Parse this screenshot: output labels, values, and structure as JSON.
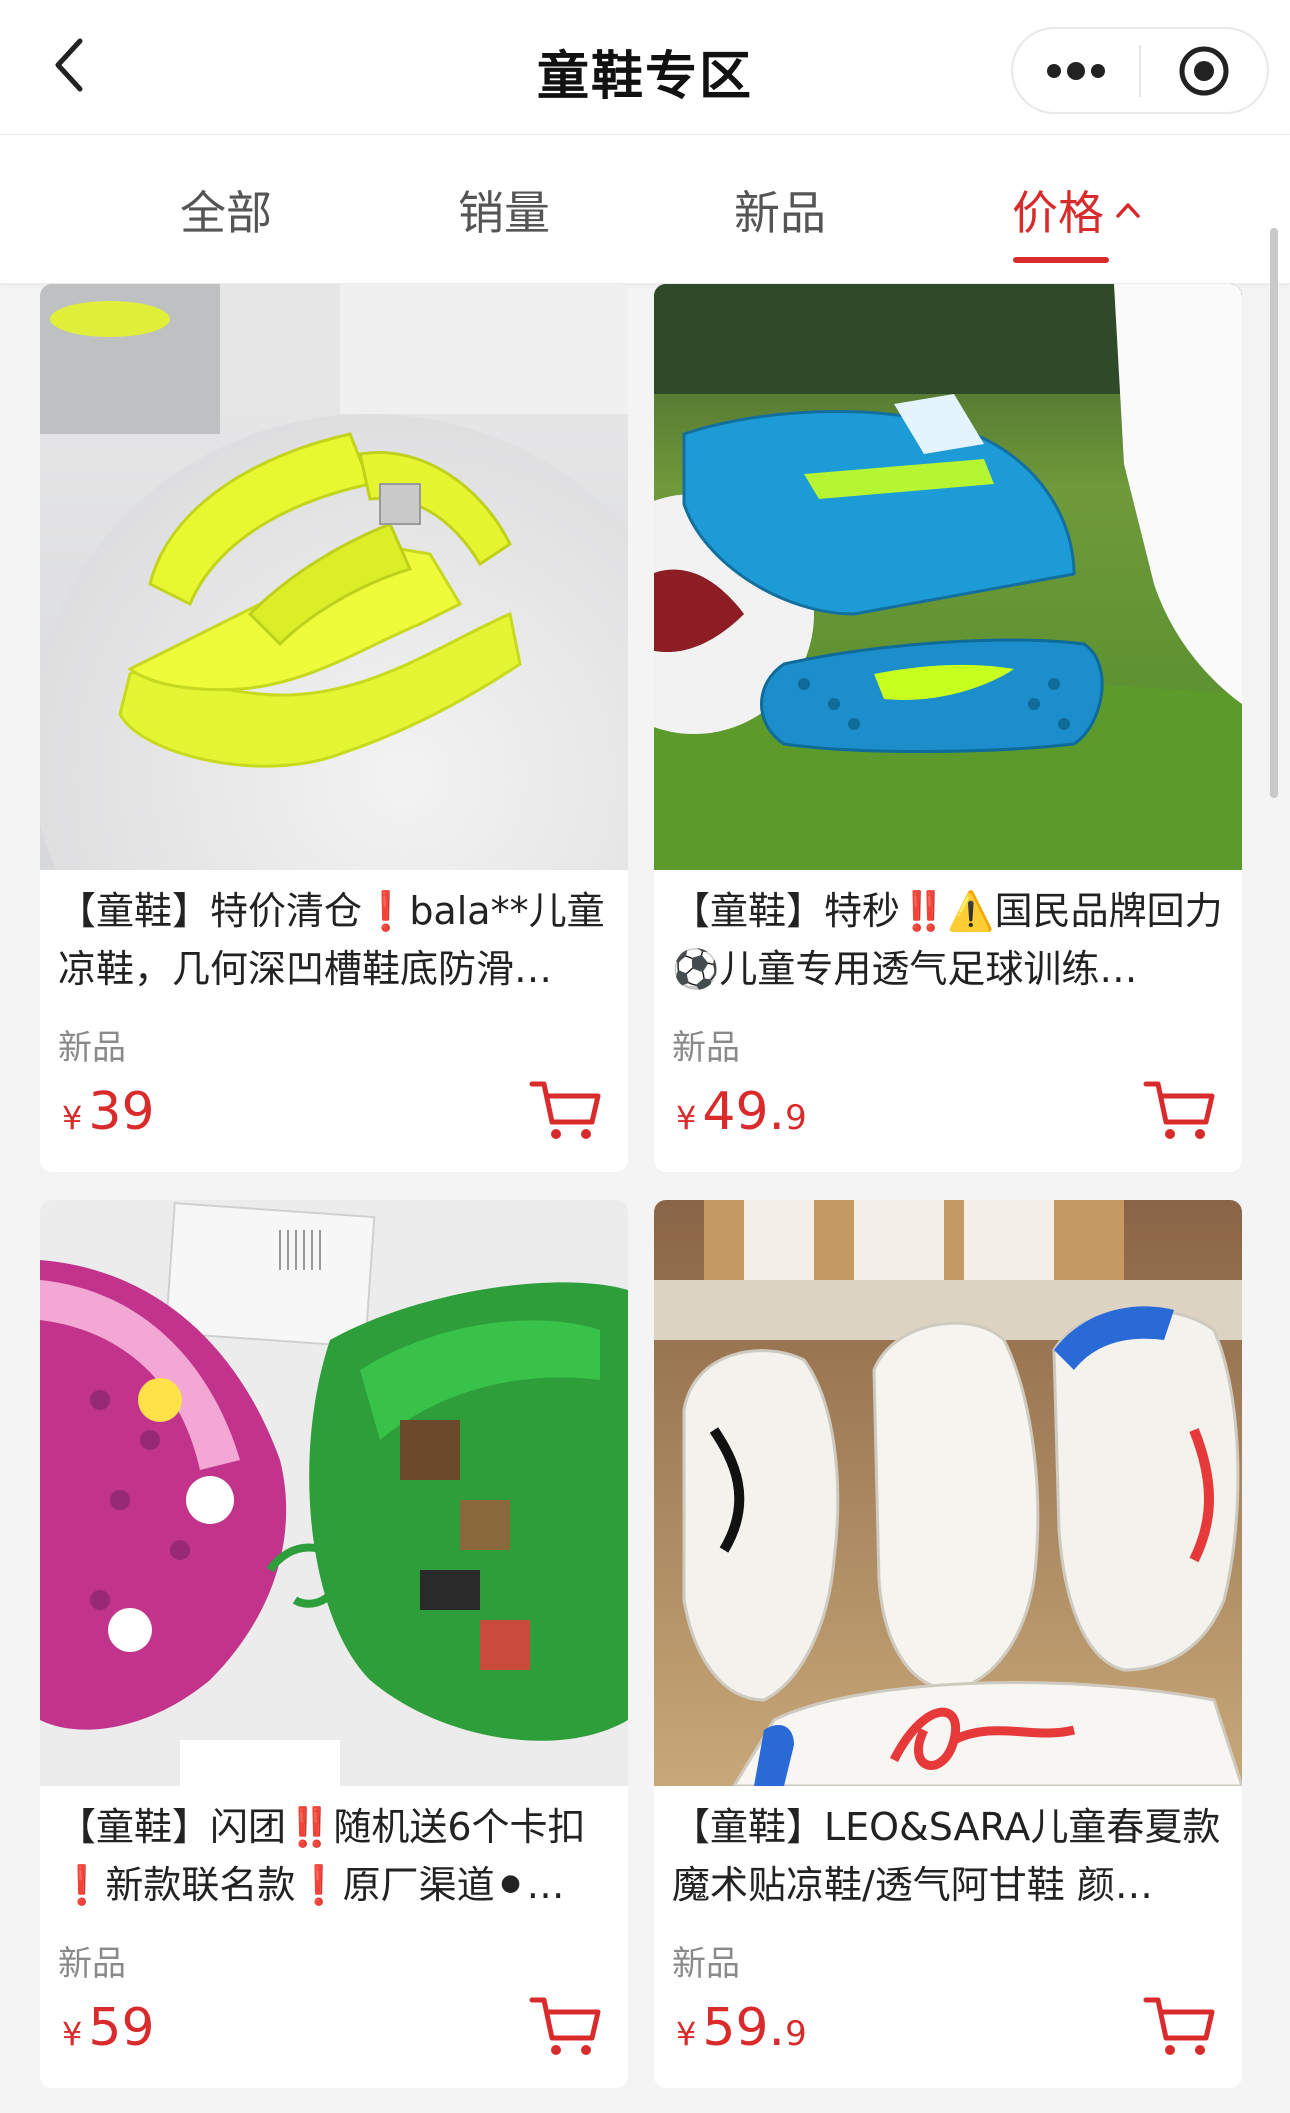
{
  "nav": {
    "title": "童鞋专区"
  },
  "tabs": [
    {
      "label": "全部",
      "active": false
    },
    {
      "label": "销量",
      "active": false
    },
    {
      "label": "新品",
      "active": false
    },
    {
      "label": "价格",
      "active": true
    }
  ],
  "colors": {
    "accent": "#d92b2b",
    "background": "#f4f4f4"
  },
  "products": [
    {
      "title": "【童鞋】特价清仓❗bala**儿童凉鞋，几何深凹槽鞋底防滑…",
      "tag": "新品",
      "price_symbol": "¥",
      "price_int": "39",
      "price_dec": "",
      "image": "neon-yellow-sandal"
    },
    {
      "title": "【童鞋】特秒‼️⚠️国民品牌回力⚽儿童专用透气足球训练…",
      "tag": "新品",
      "price_symbol": "¥",
      "price_int": "49.",
      "price_dec": "9",
      "image": "blue-football-shoe"
    },
    {
      "title": "【童鞋】闪团‼️随机送6个卡扣❗新款联名款❗原厂渠道⚫…",
      "tag": "新品",
      "price_symbol": "¥",
      "price_int": "59",
      "price_dec": "",
      "image": "crocs-clogs"
    },
    {
      "title": "【童鞋】LEO&SARA儿童春夏款魔术贴凉鞋/透气阿甘鞋 颜…",
      "tag": "新品",
      "price_symbol": "¥",
      "price_int": "59.",
      "price_dec": "9",
      "image": "white-sneakers"
    }
  ]
}
